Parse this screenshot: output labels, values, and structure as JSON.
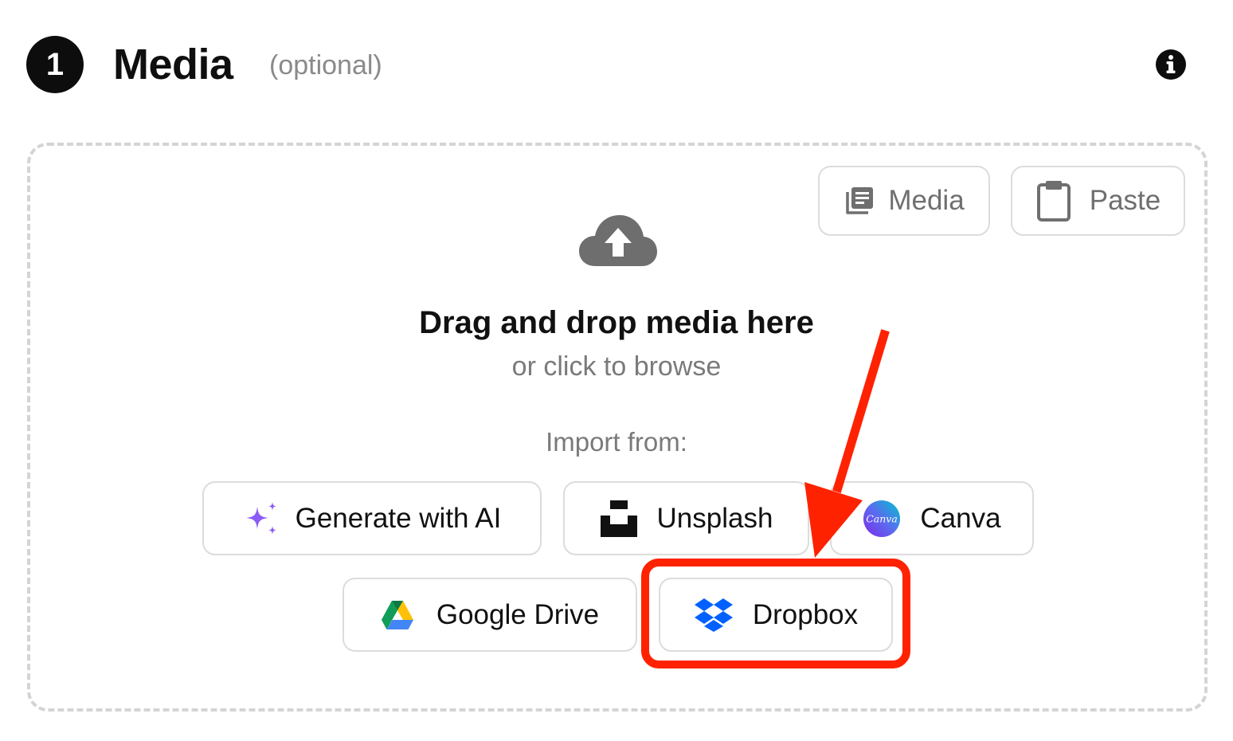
{
  "header": {
    "step_number": "1",
    "title": "Media",
    "optional_label": "(optional)"
  },
  "dropzone": {
    "media_button_label": "Media",
    "paste_button_label": "Paste",
    "title": "Drag and drop media here",
    "subtitle": "or click to browse",
    "import_label": "Import from:"
  },
  "import_sources": [
    {
      "label": "Generate with AI",
      "icon": "sparkles-icon"
    },
    {
      "label": "Unsplash",
      "icon": "unsplash-icon"
    },
    {
      "label": "Canva",
      "icon": "canva-icon",
      "icon_text": "Canva"
    },
    {
      "label": "Google Drive",
      "icon": "google-drive-icon"
    },
    {
      "label": "Dropbox",
      "icon": "dropbox-icon"
    }
  ],
  "annotation": {
    "highlight_color": "#ff2200",
    "target": "Dropbox"
  },
  "colors": {
    "accent_purple": "#8b5cf6",
    "dropbox_blue": "#0061fe"
  }
}
